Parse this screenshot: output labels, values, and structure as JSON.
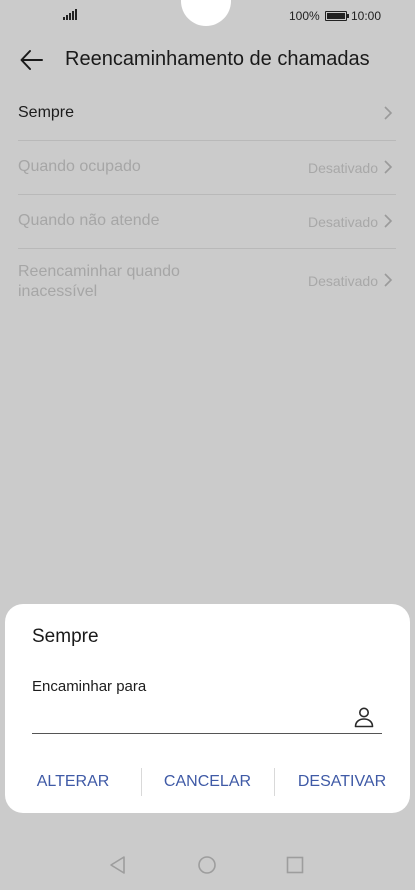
{
  "status_bar": {
    "battery_text": "100%",
    "battery_level": 1.0,
    "time": "10:00"
  },
  "header": {
    "title": "Reencaminhamento de chamadas",
    "back_icon": "arrow-left-icon"
  },
  "list": {
    "items": [
      {
        "label": "Sempre",
        "status": "",
        "enabled": true
      },
      {
        "label": "Quando ocupado",
        "status": "Desativado",
        "enabled": false
      },
      {
        "label": "Quando não atende",
        "status": "Desativado",
        "enabled": false
      },
      {
        "label": "Reencaminhar quando inacessível",
        "status": "Desativado",
        "enabled": false
      }
    ]
  },
  "dialog": {
    "title": "Sempre",
    "field_label": "Encaminhar para",
    "field_value": "",
    "contact_icon": "contact-person-icon",
    "actions": {
      "alter": "ALTERAR",
      "cancel": "CANCELAR",
      "disable": "DESATIVAR"
    }
  },
  "colors": {
    "dim_background": "#cbcbcb",
    "accent": "#3f5aa6",
    "disabled_text": "#a6a6a6"
  },
  "nav_bar": {
    "icons": [
      "back-triangle-icon",
      "home-circle-icon",
      "recents-square-icon"
    ]
  }
}
